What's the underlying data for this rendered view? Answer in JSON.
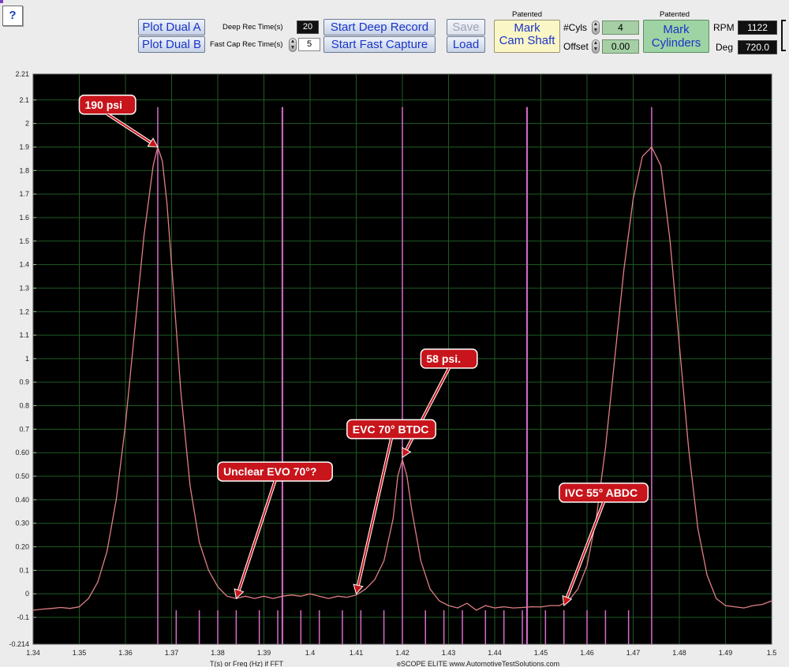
{
  "toolbar": {
    "help_label": "?",
    "plot_dual_a_label": "Plot Dual A",
    "plot_dual_b_label": "Plot Dual B",
    "deep_rec_time_label": "Deep Rec Time(s)",
    "deep_rec_time_value": "20",
    "fast_cap_rec_time_label": "Fast Cap Rec Time(s)",
    "fast_cap_rec_time_value": "5",
    "start_deep_record_label": "Start Deep Record",
    "start_fast_capture_label": "Start Fast Capture",
    "save_label": "Save",
    "load_label": "Load",
    "patented_label_1": "Patented",
    "mark_cam_shaft_line1": "Mark",
    "mark_cam_shaft_line2": "Cam Shaft",
    "cyls_label": "#Cyls",
    "cyls_value": "4",
    "offset_label": "Offset",
    "offset_value": "0.00",
    "patented_label_2": "Patented",
    "mark_cylinders_line1": "Mark",
    "mark_cylinders_line2": "Cylinders",
    "rpm_label": "RPM",
    "rpm_value": "1122",
    "deg_label": "Deg",
    "deg_value": "720.0"
  },
  "chart_data": {
    "type": "line",
    "xlim": [
      1.34,
      1.5
    ],
    "ylim": [
      -0.214,
      2.21
    ],
    "y_ticks": [
      "2.21",
      "2.1",
      "2",
      "1.9",
      "1.8",
      "1.7",
      "1.6",
      "1.5",
      "1.4",
      "1.3",
      "1.2",
      "1.1",
      "1",
      "0.9",
      "0.8",
      "0.7",
      "0.60",
      "0.50",
      "0.40",
      "0.30",
      "0.20",
      "0.1",
      "0",
      "-0.1",
      "-0.214"
    ],
    "x_ticks": [
      "1.34",
      "1.35",
      "1.36",
      "1.37",
      "1.38",
      "1.39",
      "1.4",
      "1.41",
      "1.42",
      "1.43",
      "1.44",
      "1.45",
      "1.46",
      "1.47",
      "1.48",
      "1.49",
      "1.5"
    ],
    "x_ticks_values": [
      1.34,
      1.35,
      1.36,
      1.37,
      1.38,
      1.39,
      1.4,
      1.41,
      1.42,
      1.43,
      1.44,
      1.45,
      1.46,
      1.47,
      1.48,
      1.49,
      1.5
    ],
    "y_ticks_values": [
      2.21,
      2.1,
      2.0,
      1.9,
      1.8,
      1.7,
      1.6,
      1.5,
      1.4,
      1.3,
      1.2,
      1.1,
      1.0,
      0.9,
      0.8,
      0.7,
      0.6,
      0.5,
      0.4,
      0.3,
      0.2,
      0.1,
      0.0,
      -0.1,
      -0.214
    ],
    "grid": true,
    "xlabel": "T(s) or Freq (Hz) if FFT",
    "footer_text": "eSCOPE ELITE  www.AutomotiveTestSolutions.com",
    "series": [
      {
        "color": "#e07e86",
        "points": [
          [
            1.34,
            -0.07
          ],
          [
            1.342,
            -0.065
          ],
          [
            1.344,
            -0.062
          ],
          [
            1.346,
            -0.058
          ],
          [
            1.348,
            -0.062
          ],
          [
            1.35,
            -0.055
          ],
          [
            1.352,
            -0.02
          ],
          [
            1.354,
            0.05
          ],
          [
            1.356,
            0.18
          ],
          [
            1.358,
            0.4
          ],
          [
            1.36,
            0.72
          ],
          [
            1.362,
            1.12
          ],
          [
            1.364,
            1.52
          ],
          [
            1.366,
            1.82
          ],
          [
            1.367,
            1.9
          ],
          [
            1.368,
            1.84
          ],
          [
            1.369,
            1.66
          ],
          [
            1.37,
            1.4
          ],
          [
            1.372,
            0.86
          ],
          [
            1.374,
            0.46
          ],
          [
            1.376,
            0.22
          ],
          [
            1.378,
            0.1
          ],
          [
            1.38,
            0.03
          ],
          [
            1.382,
            -0.01
          ],
          [
            1.384,
            -0.02
          ],
          [
            1.386,
            -0.01
          ],
          [
            1.388,
            -0.02
          ],
          [
            1.39,
            -0.01
          ],
          [
            1.392,
            -0.02
          ],
          [
            1.394,
            -0.01
          ],
          [
            1.396,
            -0.005
          ],
          [
            1.398,
            -0.01
          ],
          [
            1.4,
            0.0
          ],
          [
            1.402,
            -0.01
          ],
          [
            1.404,
            -0.02
          ],
          [
            1.406,
            -0.01
          ],
          [
            1.408,
            -0.015
          ],
          [
            1.41,
            -0.005
          ],
          [
            1.412,
            0.02
          ],
          [
            1.414,
            0.06
          ],
          [
            1.416,
            0.14
          ],
          [
            1.418,
            0.32
          ],
          [
            1.419,
            0.5
          ],
          [
            1.42,
            0.57
          ],
          [
            1.421,
            0.5
          ],
          [
            1.422,
            0.36
          ],
          [
            1.424,
            0.14
          ],
          [
            1.426,
            0.02
          ],
          [
            1.428,
            -0.03
          ],
          [
            1.43,
            -0.05
          ],
          [
            1.432,
            -0.06
          ],
          [
            1.434,
            -0.04
          ],
          [
            1.436,
            -0.07
          ],
          [
            1.438,
            -0.05
          ],
          [
            1.44,
            -0.06
          ],
          [
            1.442,
            -0.055
          ],
          [
            1.444,
            -0.06
          ],
          [
            1.446,
            -0.058
          ],
          [
            1.448,
            -0.055
          ],
          [
            1.45,
            -0.056
          ],
          [
            1.452,
            -0.05
          ],
          [
            1.454,
            -0.05
          ],
          [
            1.456,
            -0.03
          ],
          [
            1.458,
            0.02
          ],
          [
            1.46,
            0.12
          ],
          [
            1.462,
            0.32
          ],
          [
            1.464,
            0.62
          ],
          [
            1.466,
            1.0
          ],
          [
            1.468,
            1.38
          ],
          [
            1.47,
            1.68
          ],
          [
            1.472,
            1.86
          ],
          [
            1.474,
            1.9
          ],
          [
            1.476,
            1.82
          ],
          [
            1.478,
            1.5
          ],
          [
            1.48,
            1.06
          ],
          [
            1.482,
            0.62
          ],
          [
            1.484,
            0.28
          ],
          [
            1.486,
            0.08
          ],
          [
            1.488,
            -0.02
          ],
          [
            1.49,
            -0.05
          ],
          [
            1.492,
            -0.055
          ],
          [
            1.494,
            -0.06
          ],
          [
            1.496,
            -0.05
          ],
          [
            1.498,
            -0.045
          ],
          [
            1.5,
            -0.03
          ]
        ]
      }
    ],
    "marker_lines_tall": [
      1.367,
      1.394,
      1.42,
      1.447,
      1.474
    ],
    "marker_ticks": [
      1.371,
      1.376,
      1.38,
      1.384,
      1.389,
      1.393,
      1.398,
      1.402,
      1.407,
      1.411,
      1.416,
      1.425,
      1.429,
      1.433,
      1.438,
      1.442,
      1.446,
      1.451,
      1.455,
      1.46,
      1.464,
      1.469
    ],
    "annotations": [
      {
        "text": "190 psi",
        "target": [
          1.367,
          1.9
        ],
        "box_at": [
          1.35,
          2.08
        ]
      },
      {
        "text": "58 psi.",
        "target": [
          1.42,
          0.58
        ],
        "box_at": [
          1.424,
          1.0
        ]
      },
      {
        "text": "EVC 70° BTDC",
        "target": [
          1.41,
          0.0
        ],
        "box_at": [
          1.408,
          0.7
        ]
      },
      {
        "text": "Unclear EVO 70°?",
        "target": [
          1.384,
          -0.02
        ],
        "box_at": [
          1.38,
          0.52
        ]
      },
      {
        "text": "IVC 55° ABDC",
        "target": [
          1.455,
          -0.05
        ],
        "box_at": [
          1.454,
          0.43
        ]
      }
    ]
  }
}
